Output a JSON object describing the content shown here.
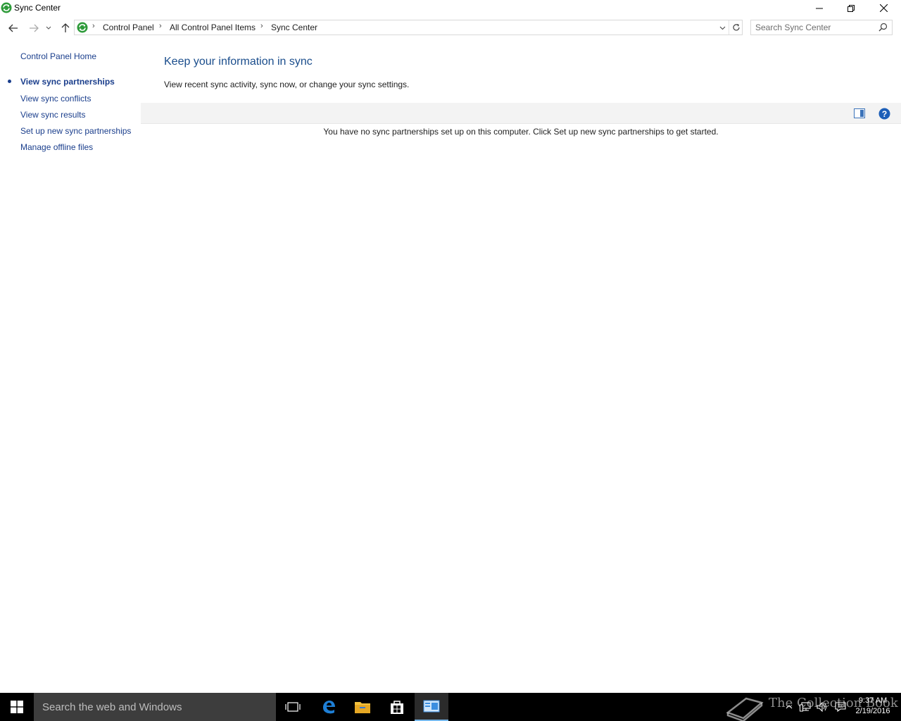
{
  "window": {
    "title": "Sync Center",
    "icon": "sync-center-icon"
  },
  "nav": {
    "breadcrumb": [
      "Control Panel",
      "All Control Panel Items",
      "Sync Center"
    ],
    "search_placeholder": "Search Sync Center"
  },
  "sidebar": {
    "home": "Control Panel Home",
    "items": [
      {
        "label": "View sync partnerships",
        "active": true
      },
      {
        "label": "View sync conflicts",
        "active": false
      },
      {
        "label": "View sync results",
        "active": false
      },
      {
        "label": "Set up new sync partnerships",
        "active": false
      },
      {
        "label": "Manage offline files",
        "active": false
      }
    ]
  },
  "main": {
    "title": "Keep your information in sync",
    "description": "View recent sync activity, sync now, or change your sync settings.",
    "empty_message": "You have no sync partnerships set up on this computer. Click Set up new sync partnerships to get started."
  },
  "taskbar": {
    "search_placeholder": "Search the web and Windows",
    "time": "9:37 AM",
    "date": "2/19/2016",
    "watermark": "The Collection Book"
  },
  "colors": {
    "link": "#1a3e8c",
    "heading": "#1a4d8c",
    "taskbar": "#000000",
    "toolbar": "#f3f3f3",
    "sync_green": "#2e9b3a"
  }
}
